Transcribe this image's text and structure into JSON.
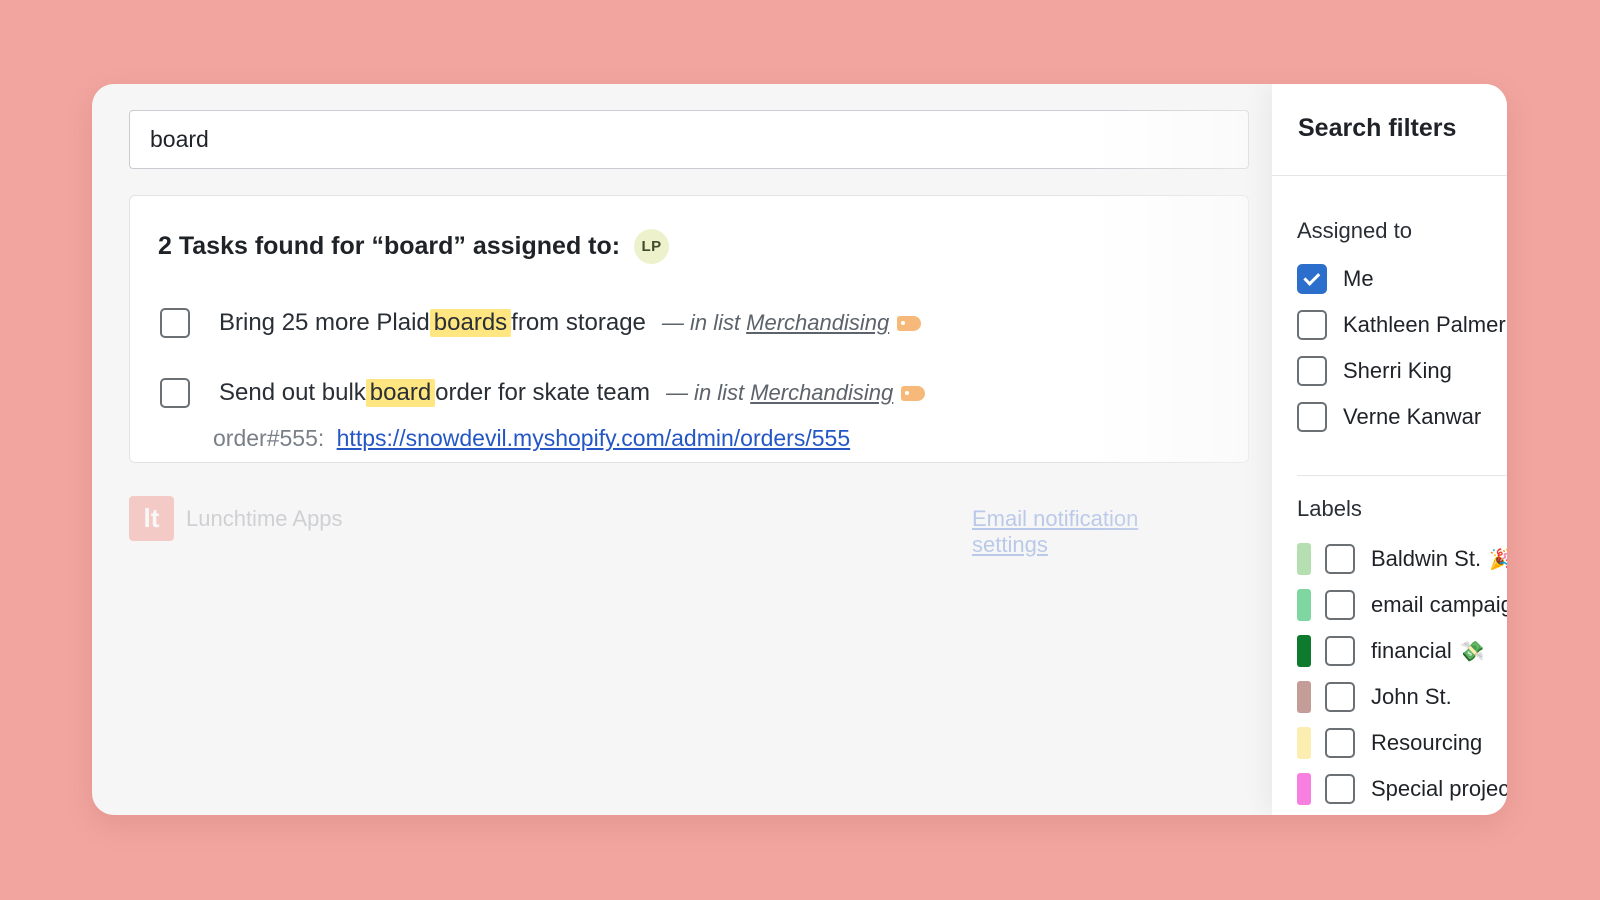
{
  "search": {
    "value": "board"
  },
  "results": {
    "heading": "2 Tasks found for “board” assigned to:",
    "avatar_initials": "LP",
    "tasks": [
      {
        "before": "Bring 25 more Plaid ",
        "highlight": "boards",
        "after": " from storage",
        "in_list_prefix": "— in list",
        "list_name": "Merchandising"
      },
      {
        "before": "Send out bulk ",
        "highlight": "board",
        "after": " order for skate team",
        "in_list_prefix": "— in list",
        "list_name": "Merchandising"
      }
    ],
    "note_label": "order#555:",
    "note_link": "https://snowdevil.myshopify.com/admin/orders/555"
  },
  "footer": {
    "logo_text": "lt",
    "brand": "Lunchtime Apps",
    "link": "Email notification settings"
  },
  "filters": {
    "title": "Search filters",
    "assigned_label": "Assigned to",
    "assignees": [
      {
        "name": "Me",
        "checked": true
      },
      {
        "name": "Kathleen Palmer",
        "checked": false
      },
      {
        "name": "Sherri King",
        "checked": false
      },
      {
        "name": "Verne Kanwar",
        "checked": false
      }
    ],
    "labels_label": "Labels",
    "labels": [
      {
        "name": "Baldwin St.",
        "emoji": "🎉",
        "color": "#b5dfb0"
      },
      {
        "name": "email campaigns",
        "emoji": "",
        "color": "#7fd6a0"
      },
      {
        "name": "financial",
        "emoji": "💸",
        "color": "#0d7a2e"
      },
      {
        "name": "John St.",
        "emoji": "",
        "color": "#c49d98"
      },
      {
        "name": "Resourcing",
        "emoji": "",
        "color": "#fbeeb0"
      },
      {
        "name": "Special projects",
        "emoji": "🤫",
        "color": "#f77fe0"
      }
    ]
  }
}
